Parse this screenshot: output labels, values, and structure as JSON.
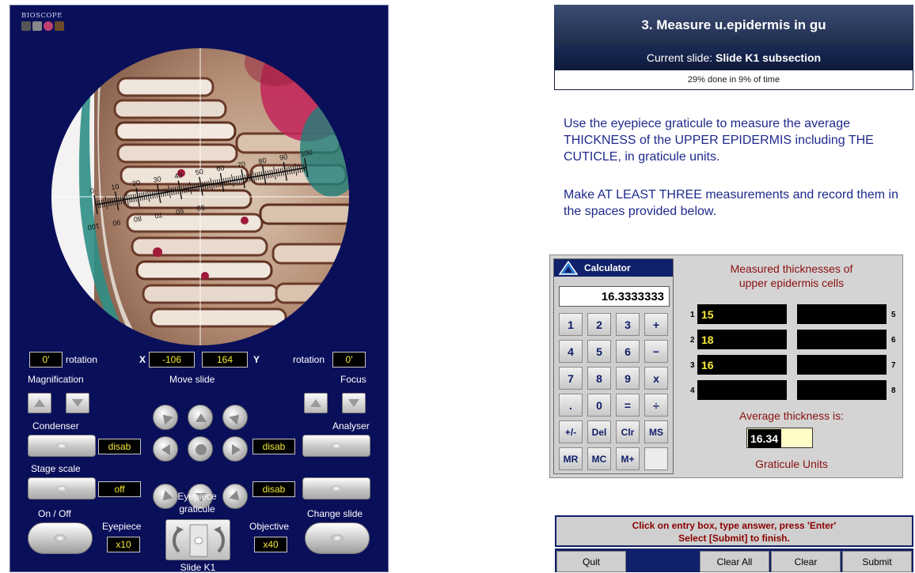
{
  "logo": {
    "text": "BIOSCOPE"
  },
  "scope": {
    "rotation_left": "0'",
    "rotation_label": "rotation",
    "x_label": "X",
    "x_value": "-106",
    "y_value": "164",
    "y_label": "Y",
    "rotation_right": "0'",
    "magnification_label": "Magnification",
    "move_slide_label": "Move slide",
    "focus_label": "Focus",
    "condenser_label": "Condenser",
    "condenser_state": "disab",
    "analyser_label": "Analyser",
    "analyser_state": "disab",
    "stage_scale_label": "Stage scale",
    "stage_scale_state": "off",
    "right_toggle_state": "disab",
    "on_off_label": "On / Off",
    "eyepiece_graticule_label_1": "Eyepiece",
    "eyepiece_graticule_label_2": "graticule",
    "change_slide_label": "Change slide",
    "eyepiece_label": "Eyepiece",
    "eyepiece_value": "x10",
    "objective_label": "Objective",
    "objective_value": "x40",
    "slide_name": "Slide K1",
    "graticule_upper_ticks": [
      "0",
      "10",
      "20",
      "30",
      "40",
      "50",
      "60",
      "70",
      "80",
      "90",
      "100"
    ],
    "graticule_lower_ticks": [
      "100",
      "90",
      "80",
      "70",
      "60",
      "50"
    ]
  },
  "task": {
    "title": "3. Measure u.epidermis in gu",
    "current_slide_prefix": "Current slide: ",
    "current_slide_name": "Slide K1 subsection",
    "progress": "29% done in 9% of time",
    "instruction_1": "Use the eyepiece graticule to measure the average THICKNESS of the UPPER EPIDERMIS including THE CUTICLE, in graticule units.",
    "instruction_2": "Make AT LEAST THREE measurements and record them in the spaces provided below."
  },
  "calculator": {
    "title": "Calculator",
    "display": "16.3333333",
    "keys": [
      "1",
      "2",
      "3",
      "+",
      "4",
      "5",
      "6",
      "−",
      "7",
      "8",
      "9",
      "x",
      ".",
      "0",
      "=",
      "÷",
      "+/-",
      "Del",
      "Clr",
      "MS",
      "MR",
      "MC",
      "M+",
      ""
    ]
  },
  "measurements": {
    "title_line1": "Measured thicknesses of",
    "title_line2": "upper epidermis cells",
    "values": [
      "15",
      "18",
      "16",
      "",
      "",
      "",
      "",
      ""
    ],
    "labels": [
      "1",
      "2",
      "3",
      "4",
      "5",
      "6",
      "7",
      "8"
    ],
    "average_label": "Average thickness is:",
    "average_value": "16.34",
    "units": "Graticule Units"
  },
  "footer": {
    "hint_line1": "Click on entry box, type answer, press 'Enter'",
    "hint_line2": "Select [Submit] to finish.",
    "quit": "Quit",
    "clear_all": "Clear All",
    "clear": "Clear",
    "submit": "Submit"
  },
  "colors": {
    "panel_bg": "#0a0f5a",
    "lcd_text": "#f5e936",
    "instruction_text": "#1e2a8c",
    "heading_red": "#8b1010"
  }
}
